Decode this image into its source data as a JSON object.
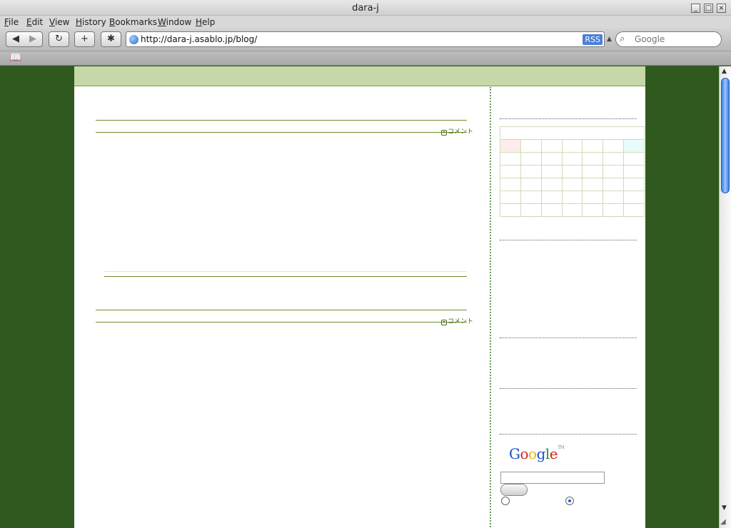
{
  "window": {
    "title": "dara-j"
  },
  "menu": {
    "items": [
      {
        "key": "F",
        "rest": "ile"
      },
      {
        "key": "E",
        "rest": "dit"
      },
      {
        "key": "V",
        "rest": "iew"
      },
      {
        "key": "H",
        "rest": "istory",
        "prefix": ""
      },
      {
        "key": "B",
        "rest": "ookmarks"
      },
      {
        "key": "W",
        "rest": "indow"
      },
      {
        "key": "H",
        "rest": "elp"
      }
    ]
  },
  "toolbar": {
    "url": "http://dara-j.asablo.jp/blog/",
    "rss_label": "RSS",
    "search_placeholder": "Google",
    "back_glyph": "◀",
    "forward_glyph": "▶",
    "reload_glyph": "↻",
    "add_glyph": "+",
    "bug_glyph": "✱"
  },
  "page": {
    "comment_label": "コメント",
    "google_logo": {
      "G": "G",
      "o1": "o",
      "o2": "o",
      "g": "g",
      "l": "l",
      "e": "e",
      "tm": "TM"
    }
  },
  "colors": {
    "page_bg": "#2f591f",
    "header_band": "#c6d7a8",
    "rule": "#6f8f2a"
  }
}
